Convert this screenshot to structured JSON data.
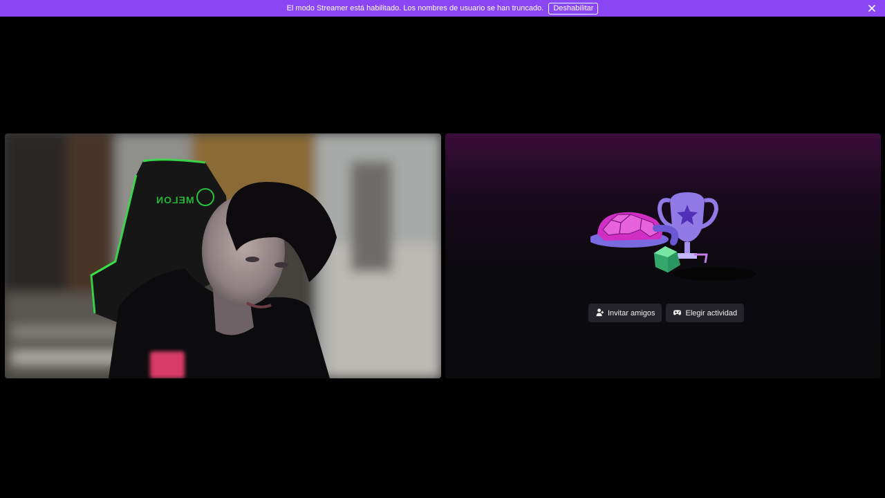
{
  "notice": {
    "message": "El modo Streamer está habilitado. Los nombres de usuario se han truncado.",
    "disable_label": "Deshabilitar",
    "bg_color": "#8b46f3",
    "close_icon": "close-icon"
  },
  "video_tile": {
    "chair_brand": "MELON"
  },
  "activity_tile": {
    "illustration": "trophy-gems-dice-illustration",
    "buttons": [
      {
        "label": "Invitar amigos",
        "icon": "invite-friends-icon"
      },
      {
        "label": "Elegir actividad",
        "icon": "gamepad-icon"
      }
    ]
  }
}
